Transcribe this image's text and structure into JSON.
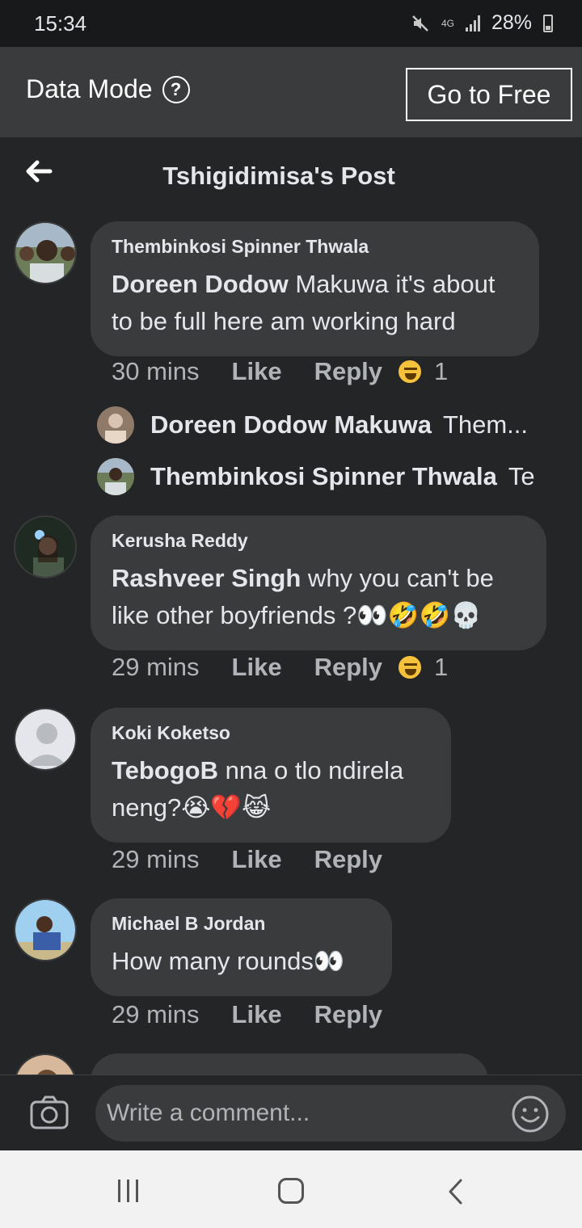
{
  "status_bar": {
    "time": "15:34",
    "network": "4G",
    "battery": "28%"
  },
  "data_mode": {
    "label": "Data Mode",
    "button": "Go to Free"
  },
  "header": {
    "title": "Tshigidimisa's Post"
  },
  "comments": [
    {
      "author": "Thembinkosi Spinner Thwala",
      "mention": "Doreen Dodow",
      "text_line1": " Makuwa it's about",
      "text_line2": "to be full here am working hard",
      "time": "30 mins",
      "like": "Like",
      "reply": "Reply",
      "reaction_count": "1",
      "replies": [
        {
          "author": "Doreen Dodow Makuwa",
          "snippet": "Them..."
        },
        {
          "author": "Thembinkosi Spinner Thwala",
          "snippet": "Te"
        }
      ]
    },
    {
      "author": "Kerusha Reddy",
      "mention": "Rashveer Singh",
      "text_line1": " why you can't be",
      "text_line2": "like other boyfriends ?👀🤣🤣💀",
      "time": "29 mins",
      "like": "Like",
      "reply": "Reply",
      "reaction_count": "1"
    },
    {
      "author": "Koki Koketso",
      "mention": "TebogoB",
      "text_line1": "  nna o tlo ndirela",
      "text_line2": "neng?😭💔😹",
      "time": "29 mins",
      "like": "Like",
      "reply": "Reply"
    },
    {
      "author": "Michael B Jordan",
      "text_line1": "How many rounds👀",
      "time": "29 mins",
      "like": "Like",
      "reply": "Reply"
    }
  ],
  "composer": {
    "placeholder": "Write a comment..."
  },
  "icons": [
    "mute-icon",
    "signal-icon",
    "battery-icon",
    "help-icon",
    "back-arrow-icon",
    "haha-reaction-icon",
    "camera-icon",
    "smiley-icon",
    "nav-recents-icon",
    "nav-home-icon",
    "nav-back-icon"
  ]
}
